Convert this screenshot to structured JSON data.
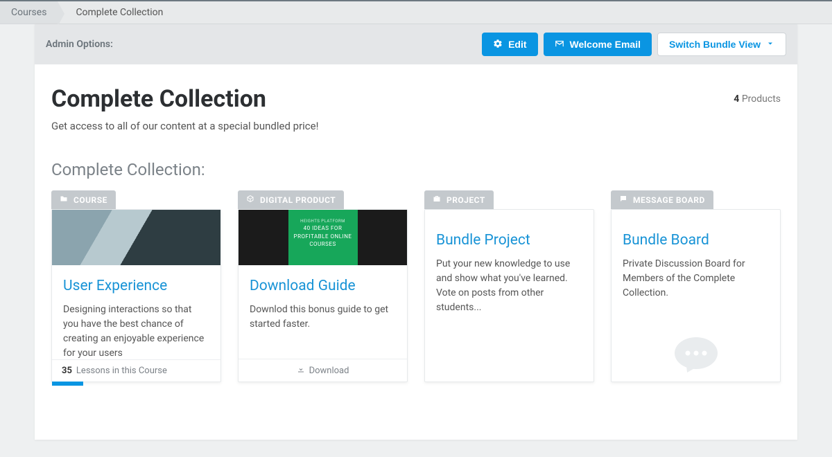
{
  "breadcrumb": {
    "root": "Courses",
    "current": "Complete Collection"
  },
  "admin": {
    "label": "Admin Options:",
    "edit": "Edit",
    "welcome_email": "Welcome Email",
    "switch_view": "Switch Bundle View"
  },
  "header": {
    "title": "Complete Collection",
    "subtitle": "Get access to all of our content at a special bundled price!",
    "product_count": "4",
    "product_label": "Products"
  },
  "section_title": "Complete Collection:",
  "cards": {
    "course": {
      "tag": "COURSE",
      "title": "User Experience",
      "desc": "Designing interactions so that you have the best chance of creating an enjoyable experience for your users",
      "lessons_count": "35",
      "lessons_label": "Lessons in this Course"
    },
    "digital": {
      "tag": "DIGITAL PRODUCT",
      "img_brand": "HEIGHTS PLATFORM",
      "img_text": "40 IDEAS FOR PROFITABLE ONLINE COURSES",
      "title": "Download Guide",
      "desc": "Downlod this bonus guide to get started faster.",
      "footer": "Download"
    },
    "project": {
      "tag": "PROJECT",
      "title": "Bundle Project",
      "desc": "Put your new knowledge to use and show what you've learned. Vote on posts from other students..."
    },
    "board": {
      "tag": "MESSAGE BOARD",
      "title": "Bundle Board",
      "desc": "Private Discussion Board for Members of the Complete Collection."
    }
  }
}
